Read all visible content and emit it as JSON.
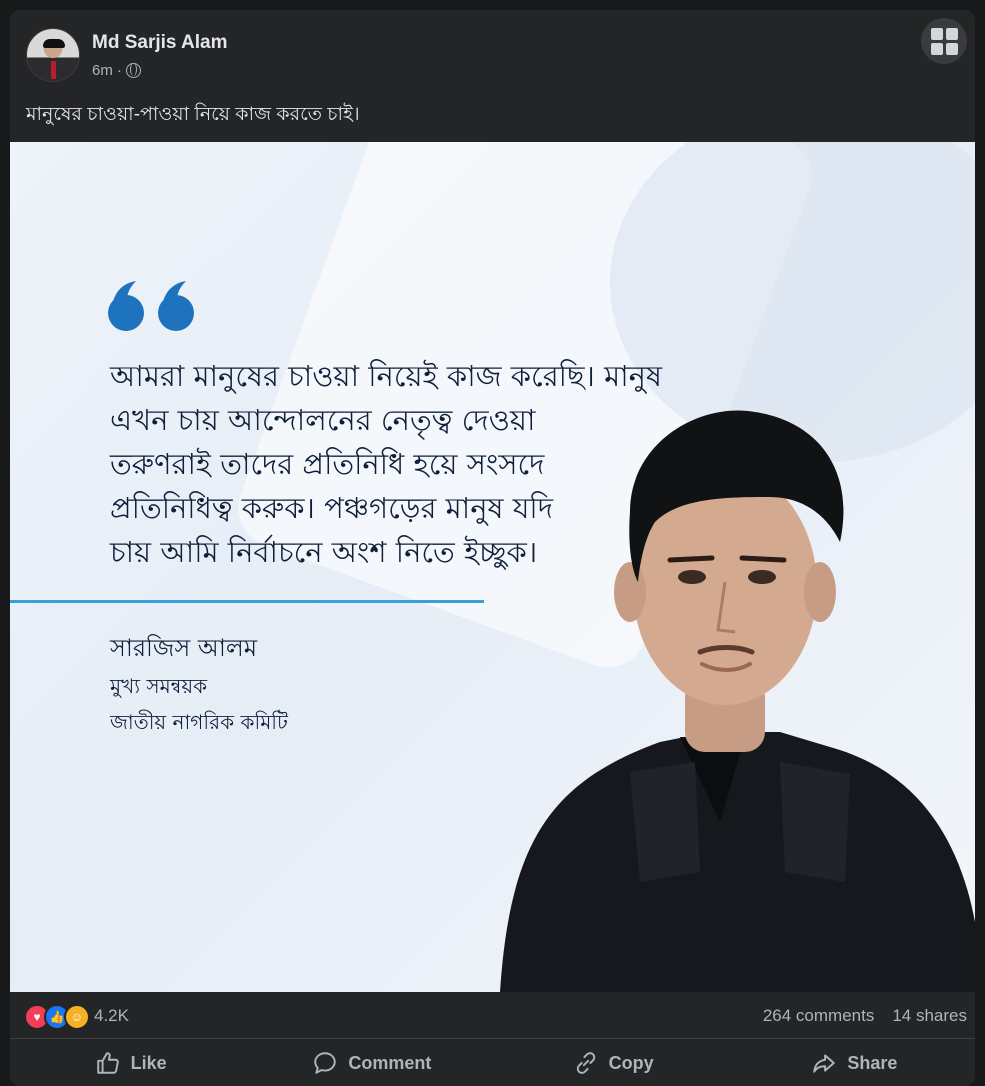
{
  "post": {
    "author": "Md Sarjis Alam",
    "time": "6m",
    "separator": "·",
    "caption": "মানুষের চাওয়া-পাওয়া নিয়ে কাজ করতে চাই।"
  },
  "image": {
    "quote_lines": [
      "আমরা মানুষের চাওয়া নিয়েই কাজ করেছি। মানুষ",
      "এখন চায় আন্দোলনের নেতৃত্ব দেওয়া",
      "তরুণরাই তাদের প্রতিনিধি হয়ে সংসদে",
      "প্রতিনিধিত্ব করুক। পঞ্চগড়ের মানুষ যদি",
      "চায় আমি নির্বাচনে অংশ নিতে ইচ্ছুক।"
    ],
    "signature_name": "সারজিস আলম",
    "signature_role": "মুখ্য সমন্বয়ক",
    "signature_org": "জাতীয় নাগরিক কমিটি",
    "accent_color": "#1e73be"
  },
  "engagement": {
    "reaction_count": "4.2K",
    "comments": "264 comments",
    "shares": "14 shares"
  },
  "actions": {
    "like": "Like",
    "comment": "Comment",
    "copy": "Copy",
    "share": "Share"
  },
  "icons": [
    "globe-icon",
    "more-options-icon",
    "love-reaction-icon",
    "like-reaction-icon",
    "care-reaction-icon",
    "like-icon",
    "comment-icon",
    "copy-icon",
    "share-icon"
  ]
}
